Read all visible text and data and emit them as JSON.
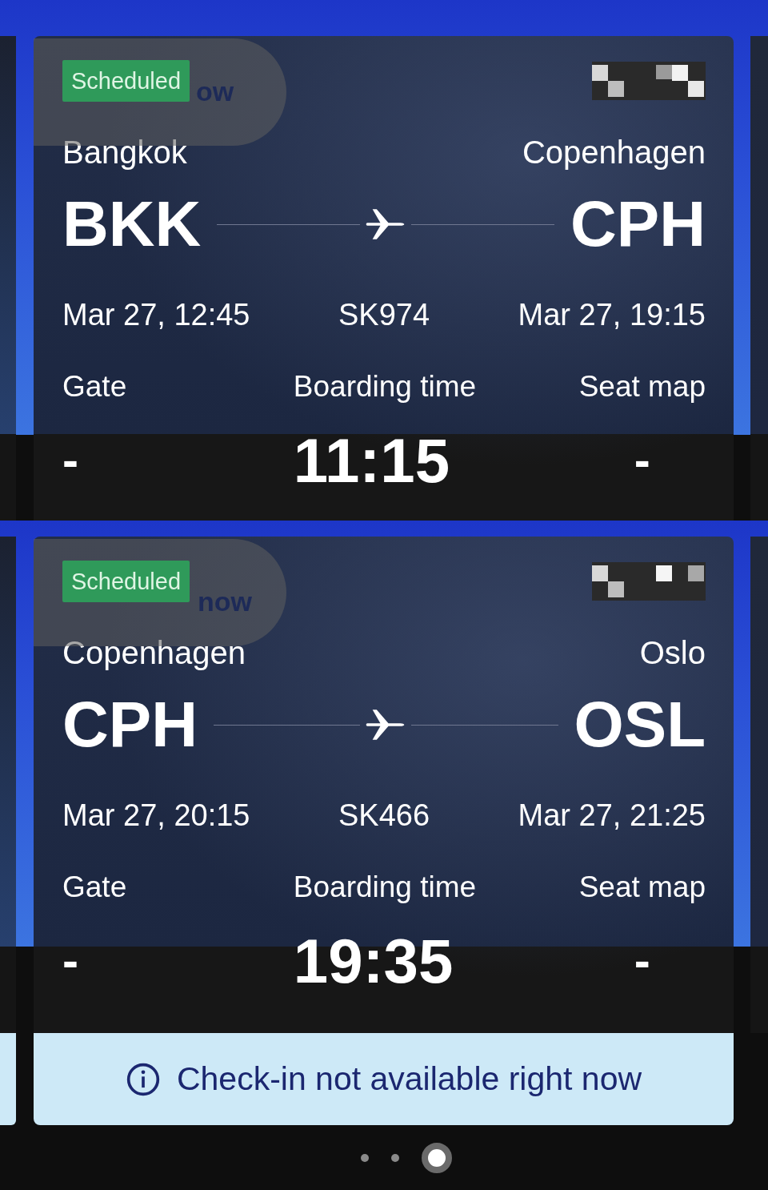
{
  "flights": [
    {
      "status": "Scheduled",
      "ghost_label": "ow",
      "origin": {
        "city": "Bangkok",
        "code": "BKK",
        "time": "Mar 27, 12:45"
      },
      "flight_number": "SK974",
      "destination": {
        "city": "Copenhagen",
        "code": "CPH",
        "time": "Mar 27, 19:15"
      },
      "gate": {
        "label": "Gate",
        "value": "-"
      },
      "boarding": {
        "label": "Boarding time",
        "value": "11:15"
      },
      "seat_map": {
        "label": "Seat map",
        "value": "-"
      }
    },
    {
      "status": "Scheduled",
      "ghost_label": "now",
      "origin": {
        "city": "Copenhagen",
        "code": "CPH",
        "time": "Mar 27, 20:15"
      },
      "flight_number": "SK466",
      "destination": {
        "city": "Oslo",
        "code": "OSL",
        "time": "Mar 27, 21:25"
      },
      "gate": {
        "label": "Gate",
        "value": "-"
      },
      "boarding": {
        "label": "Boarding time",
        "value": "19:35"
      },
      "seat_map": {
        "label": "Seat map",
        "value": "-"
      }
    }
  ],
  "notice": {
    "text": "Check-in not available right now"
  },
  "pager": [
    {
      "selected": false
    },
    {
      "selected": false
    },
    {
      "selected": true
    }
  ]
}
